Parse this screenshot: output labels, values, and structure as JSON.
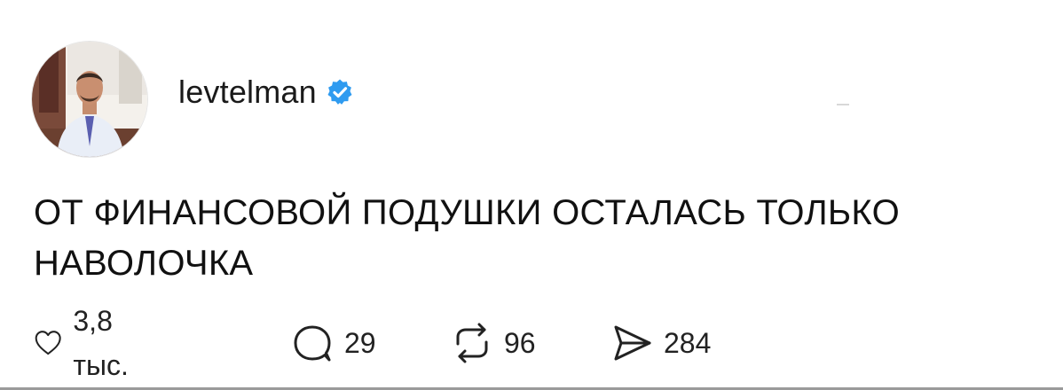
{
  "post": {
    "username": "levtelman",
    "verified": true,
    "text_line1": "ОТ ФИНАНСОВОЙ ПОДУШКИ ОСТАЛАСЬ ТОЛЬКО",
    "text_line2": "НАВОЛОЧКА",
    "actions": {
      "likes": "3,8 тыс.",
      "replies": "29",
      "reposts": "96",
      "shares": "284"
    }
  },
  "colors": {
    "verified_badge": "#2f9bf0",
    "text": "#111111",
    "icon": "#222222"
  },
  "icons": {
    "like": "heart-icon",
    "reply": "comment-bubble-icon",
    "repost": "repost-arrows-icon",
    "share": "paper-plane-icon",
    "verified": "verified-badge-icon"
  }
}
